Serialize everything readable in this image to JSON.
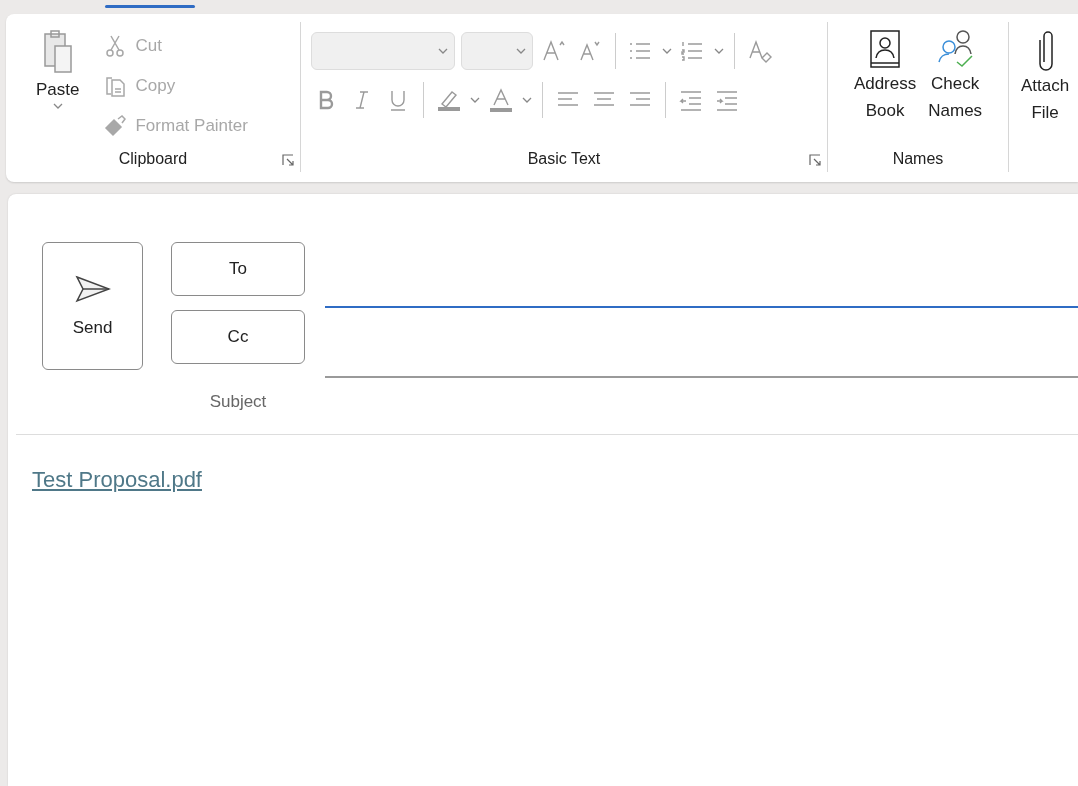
{
  "ribbon": {
    "clipboard": {
      "label": "Clipboard",
      "paste": {
        "label": "Paste",
        "disabled": false
      },
      "items": [
        {
          "kind": "cut",
          "label": "Cut",
          "disabled": true
        },
        {
          "kind": "copy",
          "label": "Copy",
          "disabled": true
        },
        {
          "kind": "painter",
          "label": "Format Painter",
          "disabled": true
        }
      ]
    },
    "basic_text": {
      "label": "Basic Text",
      "disabled": true
    },
    "names": {
      "label": "Names",
      "buttons": [
        {
          "kind": "book",
          "label": "Address\nBook"
        },
        {
          "kind": "check",
          "label": "Check\nNames"
        }
      ]
    },
    "attach": {
      "label": "Attach\nFile"
    }
  },
  "compose": {
    "send": "Send",
    "to": {
      "label": "To",
      "focused": true
    },
    "cc": {
      "label": "Cc",
      "focused": false
    },
    "subject": "Subject",
    "attachment": "Test Proposal.pdf"
  }
}
